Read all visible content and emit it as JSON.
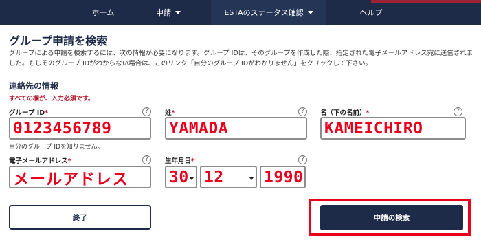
{
  "nav": {
    "items": [
      {
        "label": "ホーム"
      },
      {
        "label": "申請"
      },
      {
        "label": "ESTAのステータス確認"
      },
      {
        "label": "ヘルプ"
      }
    ]
  },
  "page": {
    "title": "グループ申請を検索",
    "description": "グループによる申請を検索するには、次の情報が必要になります。グループ IDは、そのグループを作成した際、指定された電子メールアドレス宛に送信されました。もしそのグループ IDがわからない場合は、このリンク「自分のグループ IDがわかりません」をクリックして下さい。"
  },
  "contact": {
    "section_title": "連絡先の情報",
    "required_note": "すべての欄が、入力必須です。",
    "required_mark": "*",
    "help_glyph": "?",
    "group_id": {
      "label": "グループ ID",
      "value": "0123456789",
      "forgot_link": "自分のグループ IDを知りません。"
    },
    "last_name": {
      "label": "姓",
      "value": "YAMADA"
    },
    "first_name": {
      "label": "名（下の名前）",
      "value": "KAMEICHIRO"
    },
    "email": {
      "label": "電子メールアドレス",
      "value": "メールアドレス"
    },
    "birthdate": {
      "label": "生年月日",
      "day": "30",
      "month": "12",
      "year": "1990"
    }
  },
  "buttons": {
    "end": "終了",
    "search": "申請の検索"
  },
  "colors": {
    "navy": "#1d2a48",
    "required_red": "#c8102e",
    "annotation_red": "#e8001c"
  },
  "icons": {
    "help": "question-circle-icon",
    "dropdown": "caret-down-icon"
  }
}
